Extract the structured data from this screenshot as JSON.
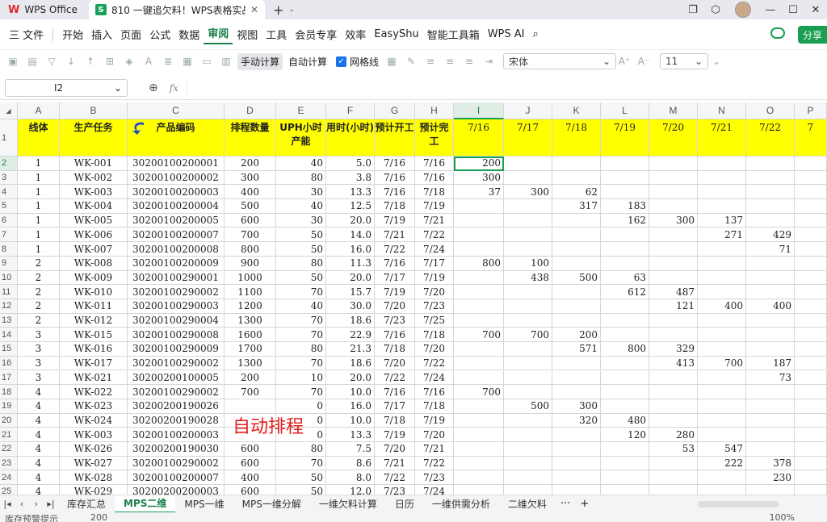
{
  "titlebar": {
    "app_name": "WPS Office",
    "doc_tab_title": "810 一键追欠料！WPS表格实战M",
    "doc_icon_letter": "S",
    "add_tab": "+",
    "dropdown": "⌄"
  },
  "menubar": {
    "file_label": "三 文件",
    "items": [
      "开始",
      "插入",
      "页面",
      "公式",
      "数据",
      "审阅",
      "视图",
      "工具",
      "会员专享",
      "效率",
      "EasyShu",
      "智能工具箱",
      "WPS AI"
    ],
    "active": "审阅",
    "share_label": "分享"
  },
  "toolbar": {
    "manual_calc": "手动计算",
    "auto_calc": "自动计算",
    "gridlines": "网格线",
    "font_name": "宋体",
    "font_size": "11"
  },
  "formulabar": {
    "cell_ref": "I2",
    "fx": "fx",
    "formula_value": ""
  },
  "sheet": {
    "columns": [
      "A",
      "B",
      "C",
      "D",
      "E",
      "F",
      "G",
      "H",
      "I",
      "J",
      "K",
      "L",
      "M",
      "N",
      "O",
      "P"
    ],
    "selected_column": "I",
    "selected_row": "2",
    "row_numbers": [
      "1",
      "2",
      "3",
      "4",
      "5",
      "6",
      "7",
      "8",
      "9",
      "10",
      "11",
      "12",
      "13",
      "14",
      "15",
      "16",
      "17",
      "18",
      "19",
      "20",
      "21",
      "22",
      "23",
      "24",
      "25"
    ],
    "header_row": [
      "线体",
      "生产任务",
      "产品编码",
      "排程数量",
      "UPH小时产能",
      "用时(小时)",
      "预计开工",
      "预计完工",
      "7/16",
      "7/17",
      "7/18",
      "7/19",
      "7/20",
      "7/21",
      "7/22",
      "7"
    ],
    "rows": [
      [
        "1",
        "WK-001",
        "30200100200001",
        "200",
        "40",
        "5.0",
        "7/16",
        "7/16",
        "200",
        "",
        "",
        "",
        "",
        "",
        "",
        ""
      ],
      [
        "1",
        "WK-002",
        "30200100200002",
        "300",
        "80",
        "3.8",
        "7/16",
        "7/16",
        "300",
        "",
        "",
        "",
        "",
        "",
        "",
        ""
      ],
      [
        "1",
        "WK-003",
        "30200100200003",
        "400",
        "30",
        "13.3",
        "7/16",
        "7/18",
        "37",
        "300",
        "62",
        "",
        "",
        "",
        "",
        ""
      ],
      [
        "1",
        "WK-004",
        "30200100200004",
        "500",
        "40",
        "12.5",
        "7/18",
        "7/19",
        "",
        "",
        "317",
        "183",
        "",
        "",
        "",
        ""
      ],
      [
        "1",
        "WK-005",
        "30200100200005",
        "600",
        "30",
        "20.0",
        "7/19",
        "7/21",
        "",
        "",
        "",
        "162",
        "300",
        "137",
        "",
        ""
      ],
      [
        "1",
        "WK-006",
        "30200100200007",
        "700",
        "50",
        "14.0",
        "7/21",
        "7/22",
        "",
        "",
        "",
        "",
        "",
        "271",
        "429",
        ""
      ],
      [
        "1",
        "WK-007",
        "30200100200008",
        "800",
        "50",
        "16.0",
        "7/22",
        "7/24",
        "",
        "",
        "",
        "",
        "",
        "",
        "71",
        ""
      ],
      [
        "2",
        "WK-008",
        "30200100200009",
        "900",
        "80",
        "11.3",
        "7/16",
        "7/17",
        "800",
        "100",
        "",
        "",
        "",
        "",
        "",
        ""
      ],
      [
        "2",
        "WK-009",
        "30200100290001",
        "1000",
        "50",
        "20.0",
        "7/17",
        "7/19",
        "",
        "438",
        "500",
        "63",
        "",
        "",
        "",
        ""
      ],
      [
        "2",
        "WK-010",
        "30200100290002",
        "1100",
        "70",
        "15.7",
        "7/19",
        "7/20",
        "",
        "",
        "",
        "612",
        "487",
        "",
        "",
        ""
      ],
      [
        "2",
        "WK-011",
        "30200100290003",
        "1200",
        "40",
        "30.0",
        "7/20",
        "7/23",
        "",
        "",
        "",
        "",
        "121",
        "400",
        "400",
        ""
      ],
      [
        "2",
        "WK-012",
        "30200100290004",
        "1300",
        "70",
        "18.6",
        "7/23",
        "7/25",
        "",
        "",
        "",
        "",
        "",
        "",
        "",
        ""
      ],
      [
        "3",
        "WK-015",
        "30200100290008",
        "1600",
        "70",
        "22.9",
        "7/16",
        "7/18",
        "700",
        "700",
        "200",
        "",
        "",
        "",
        "",
        ""
      ],
      [
        "3",
        "WK-016",
        "30200100290009",
        "1700",
        "80",
        "21.3",
        "7/18",
        "7/20",
        "",
        "",
        "571",
        "800",
        "329",
        "",
        "",
        ""
      ],
      [
        "3",
        "WK-017",
        "30200100290002",
        "1300",
        "70",
        "18.6",
        "7/20",
        "7/22",
        "",
        "",
        "",
        "",
        "413",
        "700",
        "187",
        ""
      ],
      [
        "3",
        "WK-021",
        "30200200100005",
        "200",
        "10",
        "20.0",
        "7/22",
        "7/24",
        "",
        "",
        "",
        "",
        "",
        "",
        "73",
        ""
      ],
      [
        "4",
        "WK-022",
        "30200100290002",
        "700",
        "70",
        "10.0",
        "7/16",
        "7/16",
        "700",
        "",
        "",
        "",
        "",
        "",
        "",
        ""
      ],
      [
        "4",
        "WK-023",
        "30200200190026",
        "",
        "0",
        "16.0",
        "7/17",
        "7/18",
        "",
        "500",
        "300",
        "",
        "",
        "",
        "",
        ""
      ],
      [
        "4",
        "WK-024",
        "30200200190028",
        "",
        "0",
        "10.0",
        "7/18",
        "7/19",
        "",
        "",
        "320",
        "480",
        "",
        "",
        "",
        ""
      ],
      [
        "4",
        "WK-003",
        "30200100200003",
        "",
        "0",
        "13.3",
        "7/19",
        "7/20",
        "",
        "",
        "",
        "120",
        "280",
        "",
        "",
        ""
      ],
      [
        "4",
        "WK-026",
        "30200200190030",
        "600",
        "80",
        "7.5",
        "7/20",
        "7/21",
        "",
        "",
        "",
        "",
        "53",
        "547",
        "",
        ""
      ],
      [
        "4",
        "WK-027",
        "30200100290002",
        "600",
        "70",
        "8.6",
        "7/21",
        "7/22",
        "",
        "",
        "",
        "",
        "",
        "222",
        "378",
        ""
      ],
      [
        "4",
        "WK-028",
        "30200100200007",
        "400",
        "50",
        "8.0",
        "7/22",
        "7/23",
        "",
        "",
        "",
        "",
        "",
        "",
        "230",
        ""
      ],
      [
        "4",
        "WK-029",
        "30200200200003",
        "600",
        "50",
        "12.0",
        "7/23",
        "7/24",
        "",
        "",
        "",
        "",
        "",
        "",
        "",
        ""
      ]
    ],
    "overlay_text": "自动排程"
  },
  "tabs": {
    "sheets": [
      "库存汇总",
      "MPS二维",
      "MPS一维",
      "MPS一维分解",
      "一维欠料计算",
      "日历",
      "一维供需分析",
      "二维欠料"
    ],
    "active": "MPS二维",
    "more": "···",
    "add": "+"
  },
  "statusbar": {
    "left": "库存预警提示",
    "sum": "200",
    "zoom": "100%"
  },
  "colors": {
    "header_fill": "#ffff00",
    "accent": "#1a9f52",
    "overlay": "#e51c1c"
  }
}
